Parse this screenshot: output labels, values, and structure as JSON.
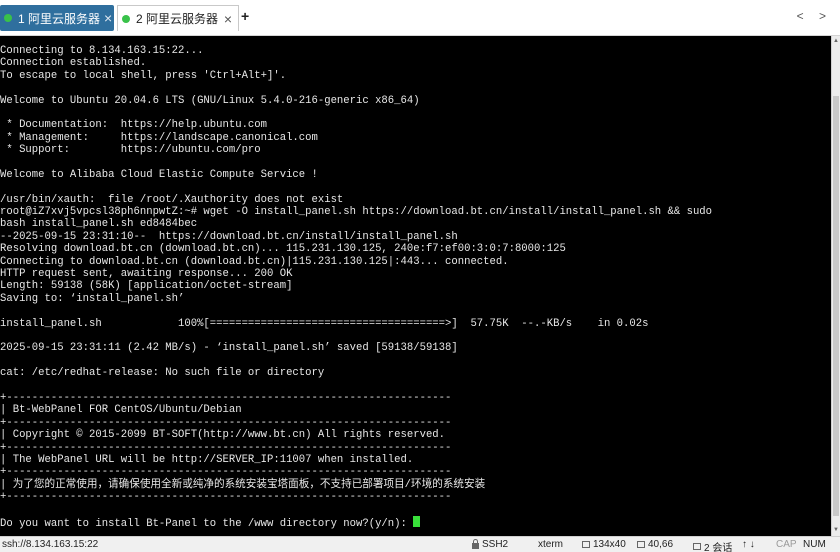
{
  "tabs": [
    {
      "label": "1 阿里云服务器",
      "active": true
    },
    {
      "label": "2 阿里云服务器",
      "active": false
    }
  ],
  "icons": {
    "tab_status": "green-dot-icon",
    "close": "close-icon",
    "new_tab": "plus-icon",
    "nav": "chevron-left-right-icon",
    "ssh_lock": "lock-icon"
  },
  "symbols": {
    "close": "×",
    "new_tab": "+",
    "nav": "< >"
  },
  "terminal": {
    "lines": [
      "Connecting to 8.134.163.15:22...",
      "Connection established.",
      "To escape to local shell, press 'Ctrl+Alt+]'.",
      "",
      "Welcome to Ubuntu 20.04.6 LTS (GNU/Linux 5.4.0-216-generic x86_64)",
      "",
      " * Documentation:  https://help.ubuntu.com",
      " * Management:     https://landscape.canonical.com",
      " * Support:        https://ubuntu.com/pro",
      "",
      "Welcome to Alibaba Cloud Elastic Compute Service !",
      "",
      "/usr/bin/xauth:  file /root/.Xauthority does not exist",
      "root@iZ7xvj5vpcsl38ph6nnpwtZ:~# wget -O install_panel.sh https://download.bt.cn/install/install_panel.sh && sudo",
      "bash install_panel.sh ed8484bec",
      "--2025-09-15 23:31:10--  https://download.bt.cn/install/install_panel.sh",
      "Resolving download.bt.cn (download.bt.cn)... 115.231.130.125, 240e:f7:ef00:3:0:7:8000:125",
      "Connecting to download.bt.cn (download.bt.cn)|115.231.130.125|:443... connected.",
      "HTTP request sent, awaiting response... 200 OK",
      "Length: 59138 (58K) [application/octet-stream]",
      "Saving to: ‘install_panel.sh’",
      "",
      "install_panel.sh            100%[=====================================>]  57.75K  --.-KB/s    in 0.02s",
      "",
      "2025-09-15 23:31:11 (2.42 MB/s) - ‘install_panel.sh’ saved [59138/59138]",
      "",
      "cat: /etc/redhat-release: No such file or directory",
      "",
      "+----------------------------------------------------------------------",
      "| Bt-WebPanel FOR CentOS/Ubuntu/Debian",
      "+----------------------------------------------------------------------",
      "| Copyright © 2015-2099 BT-SOFT(http://www.bt.cn) All rights reserved.",
      "+----------------------------------------------------------------------",
      "| The WebPanel URL will be http://SERVER_IP:11007 when installed.",
      "+----------------------------------------------------------------------",
      "| 为了您的正常使用，请确保使用全新或纯净的系统安装宝塔面板，不支持已部署项目/环境的系统安装",
      "+----------------------------------------------------------------------",
      "",
      "Do you want to install Bt-Panel to the /www directory now?(y/n): "
    ]
  },
  "scrollbar": {
    "up": "▲",
    "down": "▼"
  },
  "statusbar": {
    "connection": "ssh://8.134.163.15:22",
    "protocol": "SSH2",
    "terminal_type": "xterm",
    "size": "134x40",
    "cursor_pos": "40,66",
    "sessions": "2 会话",
    "nav_arrows": "↑ ↓",
    "caps": "CAP",
    "num": "NUM"
  },
  "colors": {
    "terminal_bg": "#000000",
    "terminal_fg": "#e8e8e8",
    "cursor": "#39e03a",
    "active_tab": "#2f6f9e",
    "tab_dot": "#39c24a"
  }
}
